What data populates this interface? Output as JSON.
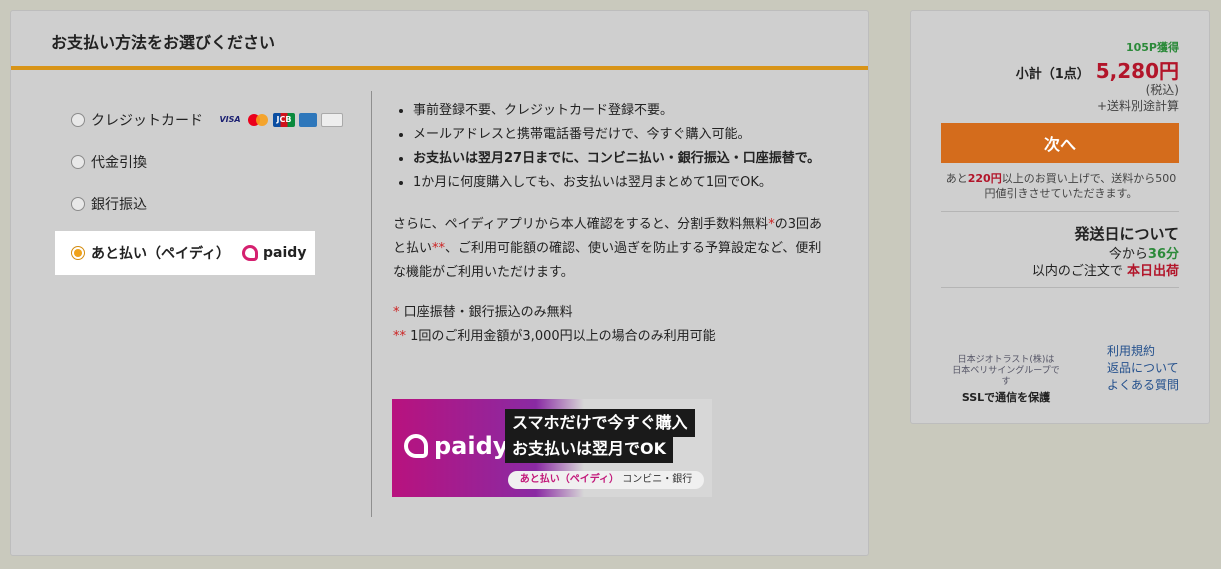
{
  "payment": {
    "title": "お支払い方法をお選びください",
    "methods": [
      {
        "label": "クレジットカード",
        "selected": false
      },
      {
        "label": "代金引換",
        "selected": false
      },
      {
        "label": "銀行振込",
        "selected": false
      },
      {
        "label": "あと払い（ペイディ）",
        "selected": true
      }
    ],
    "card_brands": [
      "VISA",
      "Mastercard",
      "JCB",
      "AMEX",
      "Diners"
    ],
    "paidy_label": "paidy"
  },
  "info": {
    "bullets": [
      "事前登録不要、クレジットカード登録不要。",
      "メールアドレスと携帯電話番号だけで、今すぐ購入可能。",
      "お支払いは翌月27日までに、コンビニ払い・銀行振込・口座振替で。",
      "1か月に何度購入しても、お支払いは翌月まとめて1回でOK。"
    ],
    "desc_part1": "さらに、ペイディアプリから本人確認をすると、分割手数料無料",
    "desc_star1": "*",
    "desc_part2": "の3回あと払い",
    "desc_star2": "**",
    "desc_part3": "、ご利用可能額の確認、使い過ぎを防止する予算設定など、便利な機能がご利用いただけます。",
    "note1_mark": "*",
    "note1": "口座振替・銀行振込のみ無料",
    "note2_mark": "**",
    "note2": "1回のご利用金額が3,000円以上の場合のみ利用可能"
  },
  "banner": {
    "logo": "paidy",
    "tagline1": "スマホだけで今すぐ購入",
    "tagline2": "お支払いは翌月でOK",
    "pill_highlight": "あと払い（ペイディ）",
    "pill_rest": "コンビニ・銀行"
  },
  "summary": {
    "points": "105P獲得",
    "subtotal_label": "小計（1点）",
    "price": "5,280円",
    "tax": "(税込)",
    "shipping_note": "+送料別途計算",
    "next_button": "次へ",
    "free_ship_pre": "あと",
    "free_ship_amount": "220円",
    "free_ship_post": "以上のお買い上げで、送料から500円値引きさせていただきます。",
    "ship_title": "発送日について",
    "ship_line1_pre": "今から",
    "ship_minutes": "36分",
    "ship_line2_pre": "以内のご注文で",
    "ship_today": "本日出荷",
    "ssl_line1": "日本ジオトラスト(株)は",
    "ssl_line2": "日本ベリサイングループです",
    "ssl_strong": "SSLで通信を保護",
    "links": [
      "利用規約",
      "返品について",
      "よくある質問"
    ]
  }
}
